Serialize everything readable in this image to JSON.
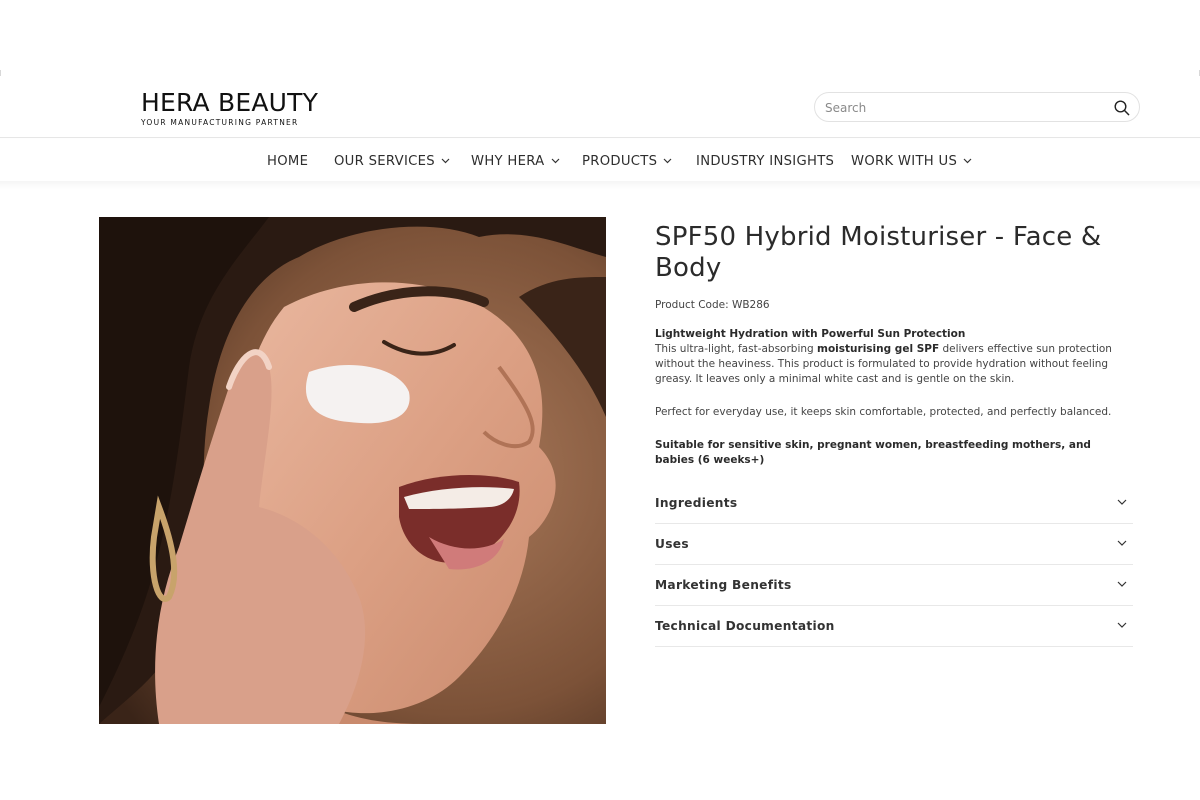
{
  "brand": {
    "name": "HERA BEAUTY",
    "tagline": "YOUR MANUFACTURING PARTNER"
  },
  "search": {
    "placeholder": "Search",
    "icon": "search-icon"
  },
  "nav": {
    "items": [
      {
        "label": "HOME",
        "has_dropdown": false
      },
      {
        "label": "OUR SERVICES",
        "has_dropdown": true
      },
      {
        "label": "WHY HERA",
        "has_dropdown": true
      },
      {
        "label": "PRODUCTS",
        "has_dropdown": true
      },
      {
        "label": "INDUSTRY INSIGHTS",
        "has_dropdown": false
      },
      {
        "label": "WORK WITH US",
        "has_dropdown": true
      }
    ]
  },
  "product": {
    "title": "SPF50 Hybrid Moisturiser - Face & Body",
    "code": "Product Code: WB286",
    "headline": "Lightweight Hydration with Powerful Sun Protection",
    "desc_pre": "This ultra-light, fast-absorbing ",
    "desc_bold": "moisturising gel SPF",
    "desc_post": " delivers effective sun protection without the heaviness. This product is formulated to provide hydration without feeling greasy. It leaves only a minimal white cast and is gentle on the skin.",
    "para2": "Perfect for everyday use, it keeps skin comfortable, protected, and perfectly balanced.",
    "para3": "Suitable for sensitive skin, pregnant women, breastfeeding mothers, and babies (6 weeks+)"
  },
  "accordion": [
    {
      "label": "Ingredients"
    },
    {
      "label": "Uses"
    },
    {
      "label": "Marketing Benefits"
    },
    {
      "label": "Technical Documentation"
    }
  ],
  "colors": {
    "text": "#2b2b2b",
    "border": "#e8e8e8",
    "background": "#ffffff"
  }
}
